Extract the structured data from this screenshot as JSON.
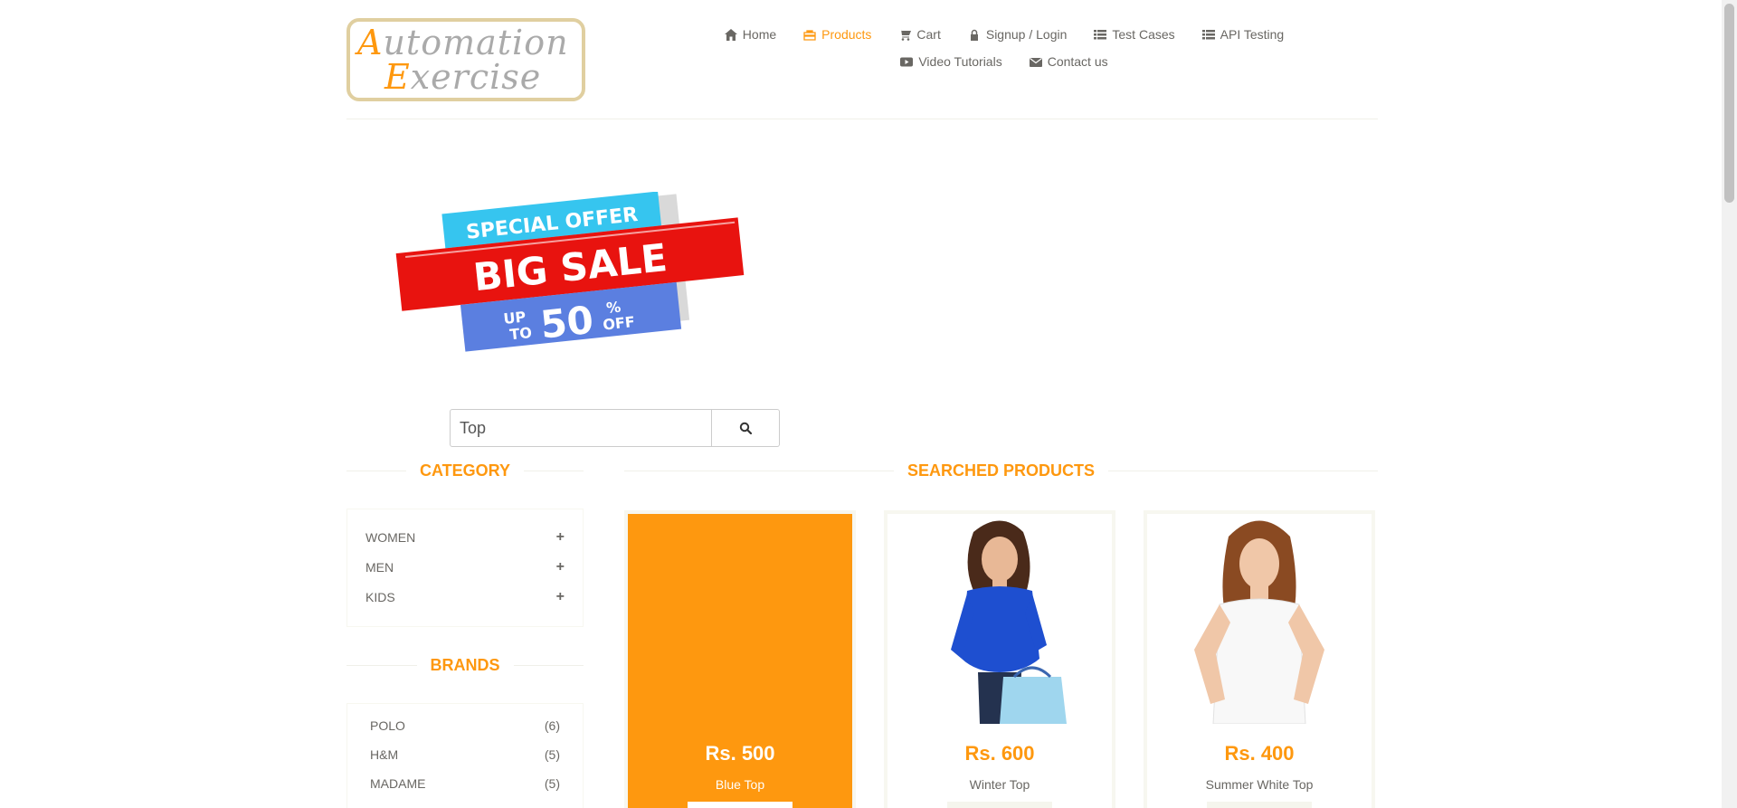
{
  "logo": {
    "line1_cap": "A",
    "line1_rest": "utomation",
    "line2_cap": "E",
    "line2_rest": "xercise"
  },
  "nav": [
    {
      "label": "Home",
      "icon": "home-icon",
      "active": false
    },
    {
      "label": "Products",
      "icon": "products-icon",
      "active": true
    },
    {
      "label": "Cart",
      "icon": "cart-icon",
      "active": false
    },
    {
      "label": "Signup / Login",
      "icon": "lock-icon",
      "active": false
    },
    {
      "label": "Test Cases",
      "icon": "list-icon",
      "active": false
    },
    {
      "label": "API Testing",
      "icon": "list-icon",
      "active": false
    },
    {
      "label": "Video Tutorials",
      "icon": "youtube-icon",
      "active": false
    },
    {
      "label": "Contact us",
      "icon": "envelope-icon",
      "active": false
    }
  ],
  "banner": {
    "line1": "SPECIAL OFFER",
    "line2": "BIG SALE",
    "line3a": "UP",
    "line3b": "TO",
    "line3c": "50",
    "line3d": "%",
    "line3e": "OFF"
  },
  "search": {
    "value": "Top"
  },
  "category": {
    "title": "Category",
    "items": [
      {
        "label": "Women",
        "toggle": "+"
      },
      {
        "label": "Men",
        "toggle": "+"
      },
      {
        "label": "Kids",
        "toggle": "+"
      }
    ]
  },
  "brands": {
    "title": "Brands",
    "items": [
      {
        "label": "POLO",
        "count": "(6)"
      },
      {
        "label": "H&M",
        "count": "(5)"
      },
      {
        "label": "MADAME",
        "count": "(5)"
      }
    ]
  },
  "products": {
    "title": "Searched Products",
    "items": [
      {
        "price": "Rs. 500",
        "name": "Blue Top"
      },
      {
        "price": "Rs. 600",
        "name": "Winter Top"
      },
      {
        "price": "Rs. 400",
        "name": "Summer White Top"
      }
    ]
  },
  "colors": {
    "accent": "#FE980F",
    "text": "#696763",
    "border": "#F7F7F0"
  }
}
